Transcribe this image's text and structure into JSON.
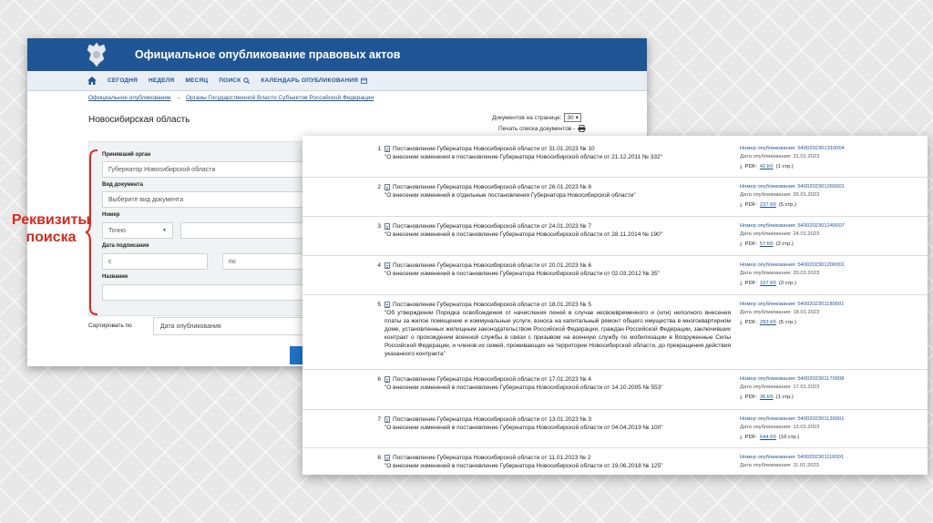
{
  "site": {
    "title": "Официальное опубликование правовых актов",
    "nav": [
      "СЕГОДНЯ",
      "НЕДЕЛЯ",
      "МЕСЯЦ",
      "ПОИСК",
      "КАЛЕНДАРЬ ОПУБЛИКОВАНИЯ"
    ],
    "breadcrumb": {
      "root": "Официальное опубликование",
      "arrow": "→",
      "current": "Органы Государственной Власти Субъектов Российской Федерации"
    },
    "region_title": "Новосибирская область",
    "docs_per_page_label": "Документов на странице:",
    "docs_per_page_value": "30",
    "print_label": "Печать списка документов -"
  },
  "form": {
    "authority_label": "Принявший орган",
    "authority_value": "Губернатор Новосибирской области",
    "doctype_label": "Вид документа",
    "doctype_placeholder": "Выберите вид документа",
    "number_label": "Номер",
    "number_mode": "Точно",
    "date_label": "Дата подписания",
    "date_from": "с",
    "date_to": "по",
    "name_label": "Название",
    "sort_label": "Сортировать по",
    "sort_value": "Дата опубликования"
  },
  "annotation": {
    "line1": "Реквизиты",
    "line2": "поиска",
    "color": "#d42a1f"
  },
  "results": [
    {
      "num": "1",
      "title": "Постановление Губернатора Новосибирской области от 31.01.2023 № 10",
      "desc": "\"О внесении изменения в постановление Губернатора Новосибирской области от 21.12.2011 № 332\"",
      "pub_num": "Номер опубликования: 5400202301310004",
      "pub_date": "Дата опубликования: 31.01.2023",
      "pdf_label": "PDF:",
      "size": "42 Кб",
      "pages": "(1 стр.)"
    },
    {
      "num": "2",
      "title": "Постановление Губернатора Новосибирской области от 26.01.2023 № 8",
      "desc": "\"О внесении изменений в отдельные постановления Губернатора Новосибирской области\"",
      "pub_num": "Номер опубликования: 5400202301260001",
      "pub_date": "Дата опубликования: 26.01.2023",
      "pdf_label": "PDF:",
      "size": "227 Кб",
      "pages": "(5 стр.)"
    },
    {
      "num": "3",
      "title": "Постановление Губернатора Новосибирской области от 24.01.2023 № 7",
      "desc": "\"О внесении изменений в постановление Губернатора Новосибирской области от 28.11.2014 № 190\"",
      "pub_num": "Номер опубликования: 5400202301240007",
      "pub_date": "Дата опубликования: 24.01.2023",
      "pdf_label": "PDF:",
      "size": "57 Кб",
      "pages": "(2 стр.)"
    },
    {
      "num": "4",
      "title": "Постановление Губернатора Новосибирской области от 20.01.2023 № 6",
      "desc": "\"О внесении изменений в постановление Губернатора Новосибирской области от 02.03.2012 № 35\"",
      "pub_num": "Номер опубликования: 5400202301200001",
      "pub_date": "Дата опубликования: 20.01.2023",
      "pdf_label": "PDF:",
      "size": "107 Кб",
      "pages": "(3 стр.)"
    },
    {
      "num": "5",
      "title": "Постановление Губернатора Новосибирской области от 18.01.2023 № 5",
      "desc": "\"Об утверждении Порядка освобождения от начисления пеней в случае несвоевременного и (или) неполного внесения платы за жилое помещение и коммунальные услуги, взноса на капитальный ремонт общего имущества в многоквартирном доме, установленных жилищным законодательством Российской Федерации, граждан Российской Федерации, заключивших контракт о прохождении военной службы в связи с призывом на военную службу по мобилизации в Вооруженные Силы Российской Федерации, и членов их семей, проживающих на территории Новосибирской области, до прекращения действия указанного контракта\"",
      "pub_num": "Номер опубликования: 5400202301180001",
      "pub_date": "Дата опубликования: 18.01.2023",
      "pdf_label": "PDF:",
      "size": "283 Кб",
      "pages": "(5 стр.)"
    },
    {
      "num": "6",
      "title": "Постановление Губернатора Новосибирской области от 17.01.2023 № 4",
      "desc": "\"О внесении изменений в постановление Губернатора Новосибирской области от 14.10.2005 № 553\"",
      "pub_num": "Номер опубликования: 5400202301170008",
      "pub_date": "Дата опубликования: 17.01.2023",
      "pdf_label": "PDF:",
      "size": "36 Кб",
      "pages": "(1 стр.)"
    },
    {
      "num": "7",
      "title": "Постановление Губернатора Новосибирской области от 13.01.2023 № 3",
      "desc": "\"О внесении изменений в постановление Губернатора Новосибирской области от 04.04.2019 № 100\"",
      "pub_num": "Номер опубликования: 5400202301130001",
      "pub_date": "Дата опубликования: 13.01.2023",
      "pdf_label": "PDF:",
      "size": "644 Кб",
      "pages": "(10 стр.)"
    },
    {
      "num": "8",
      "title": "Постановление Губернатора Новосибирской области от 11.01.2023 № 2",
      "desc": "\"О внесении изменений в постановление Губернатора Новосибирской области от 19.06.2018 № 125\"",
      "pub_num": "Номер опубликования: 5400202301110001",
      "pub_date": "Дата опубликования: 11.01.2023",
      "pdf_label": "",
      "size": "",
      "pages": ""
    }
  ]
}
